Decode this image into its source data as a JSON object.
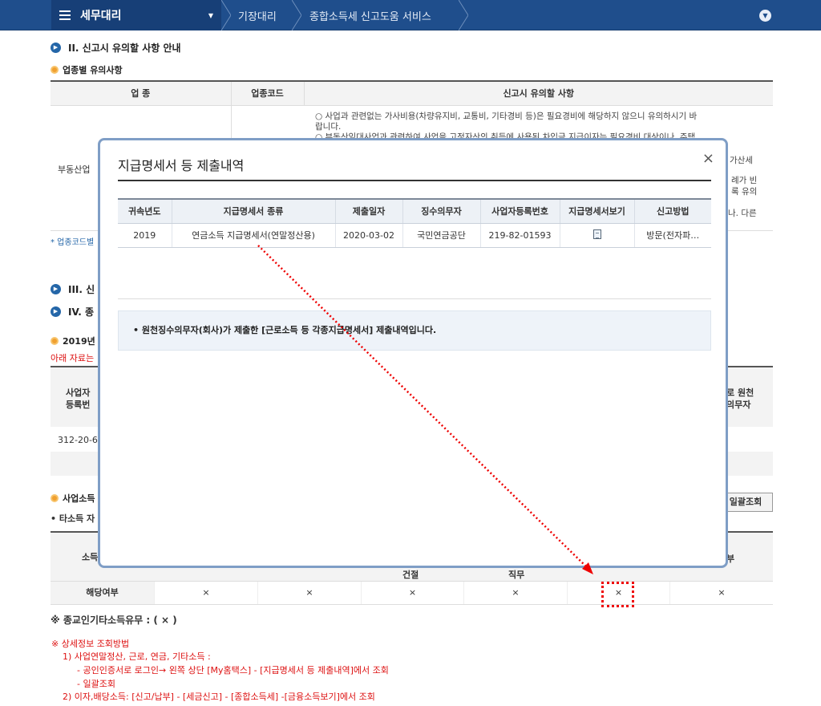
{
  "topbar": {
    "brand": "세무대리",
    "crumbs": [
      "기장대리",
      "종합소득세 신고도움 서비스"
    ]
  },
  "sections": {
    "s2_title": "II. 신고시 유의할 사항 안내",
    "s2_sub": "업종별 유의사항",
    "s3_title": "III. 신",
    "s4_title": "IV. 종",
    "year_sub": "2019년",
    "red_note": "아래 자료는",
    "code_note": "* 업종코드별",
    "biz_sub": "사업소득",
    "other_sub": "• 타소득 자"
  },
  "industry_table": {
    "headers": [
      "업 종",
      "업종코드",
      "신고시 유의할 사항"
    ],
    "row_label": "부동산업",
    "notes": [
      "○ 사업과 관련없는 가사비용(차량유지비, 교통비, 기타경비 등)은 필요경비에 해당하지 않으니 유의하시기 바",
      "랍니다.",
      "○ 부동산임대사업과 관련하여 사업을 고정자산의 취득에 사용된 차입금 지급이자는 필요경비 대상이나, 주택"
    ],
    "right_frags": [
      "가산세",
      "례가 빈",
      "록 유의",
      "나. 다른"
    ]
  },
  "bg_table": {
    "h1": [
      "사업자",
      "등록번"
    ],
    "h2": [
      "로 원천",
      "의무자"
    ],
    "id_frag": "312-20-63"
  },
  "bulk_button": "일괄조회",
  "income_table": {
    "row_label_frag": "소득",
    "row_label": "해당여부",
    "cells": [
      "×",
      "×",
      "×",
      "×",
      "×",
      "×"
    ],
    "col_frags": [
      "건절",
      "직무"
    ],
    "right_frag": "부"
  },
  "religious": "※ 종교인기타소득유무 : ( × )",
  "info_notes": [
    "※  상세정보 조회방법",
    "1) 사업연말정산, 근로, 연금, 기타소득 :",
    "- 공인인증서로 로그인→ 왼쪽 상단 [My홈택스] - [지급명세서 등 제출내역]에서 조회",
    "- 일괄조회",
    "2) 이자,배당소득: [신고/납부] - [세금신고] - [종합소득세] -[금융소득보기]에서 조회"
  ],
  "modal": {
    "title": "지급명세서 등 제출내역",
    "close": "×",
    "headers": [
      "귀속년도",
      "지급명세서 종류",
      "제출일자",
      "징수의무자",
      "사업자등록번호",
      "지급명세서보기",
      "신고방법"
    ],
    "rows": [
      {
        "year": "2019",
        "type": "연금소득 지급명세서(연말정산용)",
        "date": "2020-03-02",
        "payer": "국민연금공단",
        "regno": "219-82-01593",
        "method": "방문(전자파…"
      }
    ],
    "notice": "• 원천징수의무자(회사)가 제출한 [근로소득 등 각종지급명세서] 제출내역입니다."
  },
  "colors": {
    "nav": "#1f4e8c",
    "accent_red": "#dd0000"
  }
}
